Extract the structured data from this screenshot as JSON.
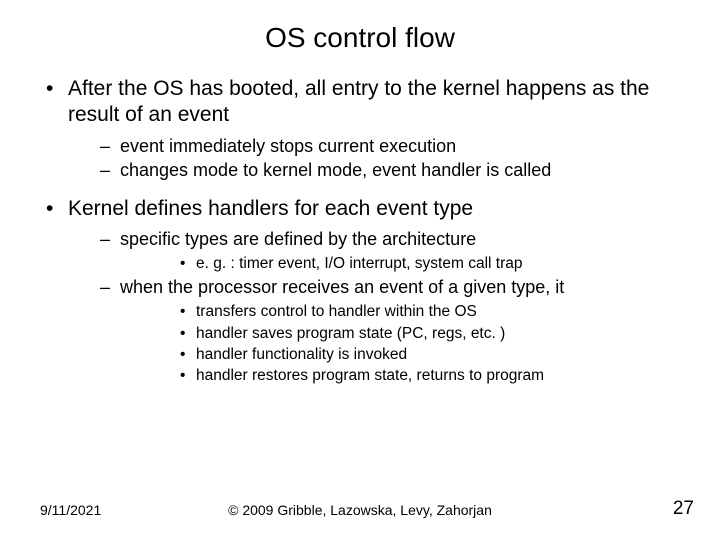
{
  "title": "OS control flow",
  "bullets": {
    "b1_text": "After the OS has booted, all entry to the kernel happens as the result of an event",
    "b1_sub1": "event immediately stops current execution",
    "b1_sub2": "changes mode to kernel mode, event  handler is called",
    "b2_text": "Kernel defines handlers for each event type",
    "b2_sub1": "specific types are defined by the architecture",
    "b2_sub1_s1": "e. g. : timer event, I/O interrupt, system call trap",
    "b2_sub2": "when the processor receives an event of a given type, it",
    "b2_sub2_s1": "transfers control to handler within the OS",
    "b2_sub2_s2": "handler saves program state (PC, regs, etc. )",
    "b2_sub2_s3": "handler functionality is invoked",
    "b2_sub2_s4": "handler restores program state, returns to program"
  },
  "footer": {
    "date": "9/11/2021",
    "copyright": "© 2009 Gribble, Lazowska, Levy, Zahorjan",
    "page": "27"
  }
}
